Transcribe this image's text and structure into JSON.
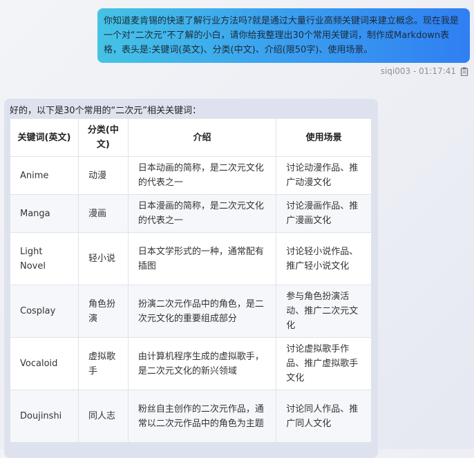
{
  "user_message": {
    "text": "你知道麦肯锡的快速了解行业方法吗?就是通过大量行业高频关键词来建立概念。现在我是一个对“二次元”不了解的小白，请你给我整理出30个常用关键词，制作成Markdown表格，表头是:关键词(英文)、分类(中文)、介绍(限50字)、使用场景。",
    "meta": "siqi003 - 01:17:41",
    "copy_icon": "clipboard-icon"
  },
  "bot_message": {
    "intro": "好的，以下是30个常用的“二次元”相关关键词：",
    "table": {
      "headers": [
        "关键词(英文)",
        "分类(中文)",
        "介绍",
        "使用场景"
      ],
      "rows": [
        {
          "keyword": "Anime",
          "category": "动漫",
          "intro": "日本动画的简称，是二次元文化的代表之一",
          "scene": "讨论动漫作品、推广动漫文化"
        },
        {
          "keyword": "Manga",
          "category": "漫画",
          "intro": "日本漫画的简称，是二次元文化的代表之一",
          "scene": "讨论漫画作品、推广漫画文化"
        },
        {
          "keyword": "Light Novel",
          "category": "轻小说",
          "intro": "日本文学形式的一种，通常配有插图",
          "scene": "讨论轻小说作品、推广轻小说文化"
        },
        {
          "keyword": "Cosplay",
          "category": "角色扮演",
          "intro": "扮演二次元作品中的角色，是二次元文化的重要组成部分",
          "scene": "参与角色扮演活动、推广二次元文化"
        },
        {
          "keyword": "Vocaloid",
          "category": "虚拟歌手",
          "intro": "由计算机程序生成的虚拟歌手，是二次元文化的新兴领域",
          "scene": "讨论虚拟歌手作品、推广虚拟歌手文化"
        },
        {
          "keyword": "Doujinshi",
          "category": "同人志",
          "intro": "粉丝自主创作的二次元作品，通常以二次元作品中的角色为主题",
          "scene": "讨论同人作品、推广同人文化"
        }
      ]
    }
  }
}
